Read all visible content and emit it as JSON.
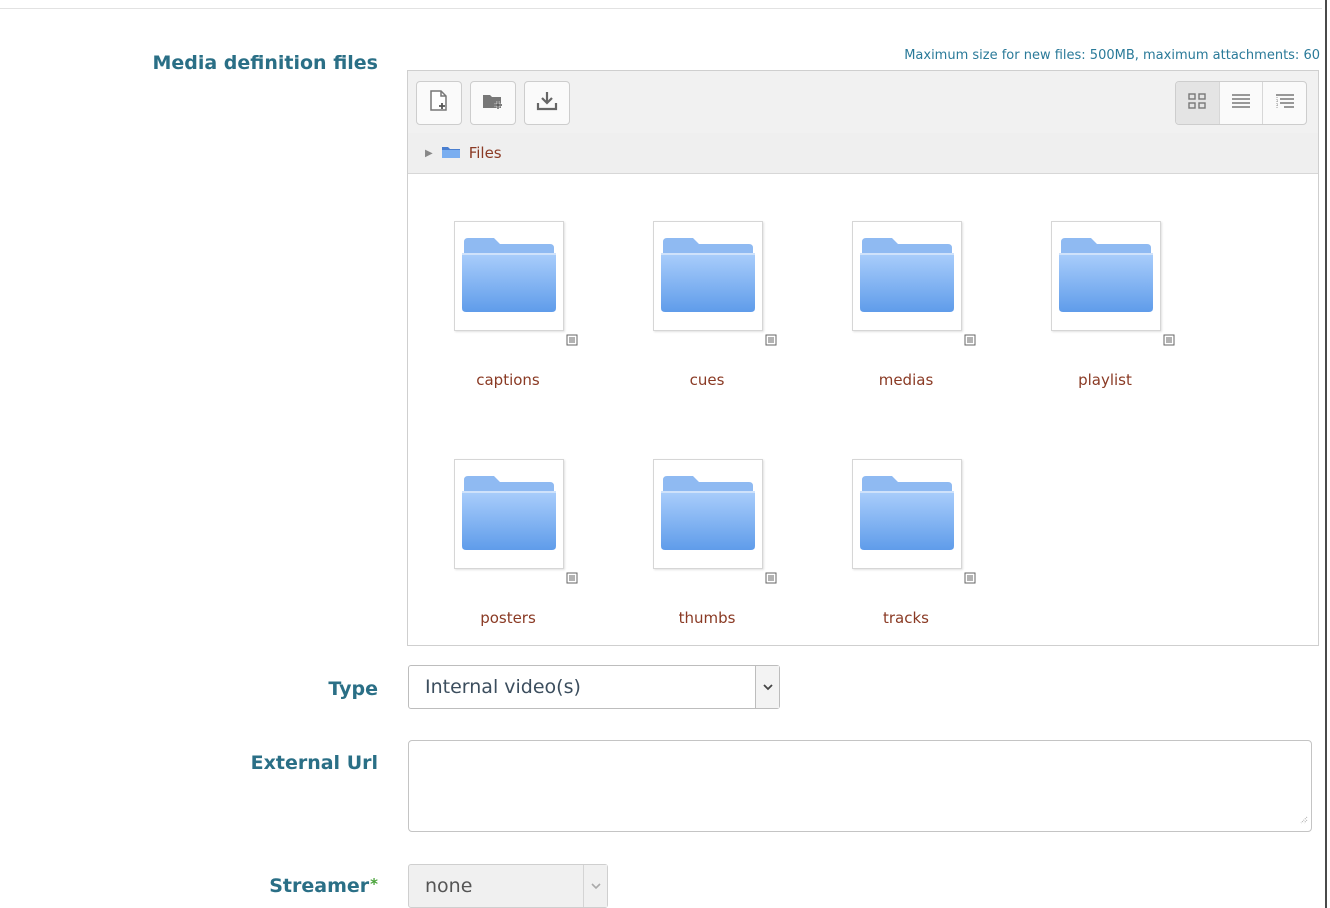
{
  "form": {
    "media_files_label": "Media definition files",
    "max_info": "Maximum size for new files: 500MB, maximum attachments: 60",
    "type_label": "Type",
    "type_value": "Internal video(s)",
    "external_url_label": "External Url",
    "external_url_value": "",
    "streamer_label": "Streamer",
    "streamer_required_mark": "*",
    "streamer_value": "none"
  },
  "filemanager": {
    "toolbar": {
      "add_file_icon": "add-file-icon",
      "create_folder_icon": "create-folder-icon",
      "download_icon": "download-icon",
      "views": [
        "icons-view",
        "list-view",
        "tree-view"
      ],
      "active_view": "icons-view"
    },
    "path": {
      "folder": "Files"
    },
    "folders": [
      {
        "name": "captions"
      },
      {
        "name": "cues"
      },
      {
        "name": "medias"
      },
      {
        "name": "playlist"
      },
      {
        "name": "posters"
      },
      {
        "name": "thumbs"
      },
      {
        "name": "tracks"
      }
    ]
  },
  "colors": {
    "label": "#2a6f86",
    "filename": "#8a3a24",
    "info": "#2a7a99",
    "required": "#4aa33b",
    "folder": "#7aaef0"
  }
}
